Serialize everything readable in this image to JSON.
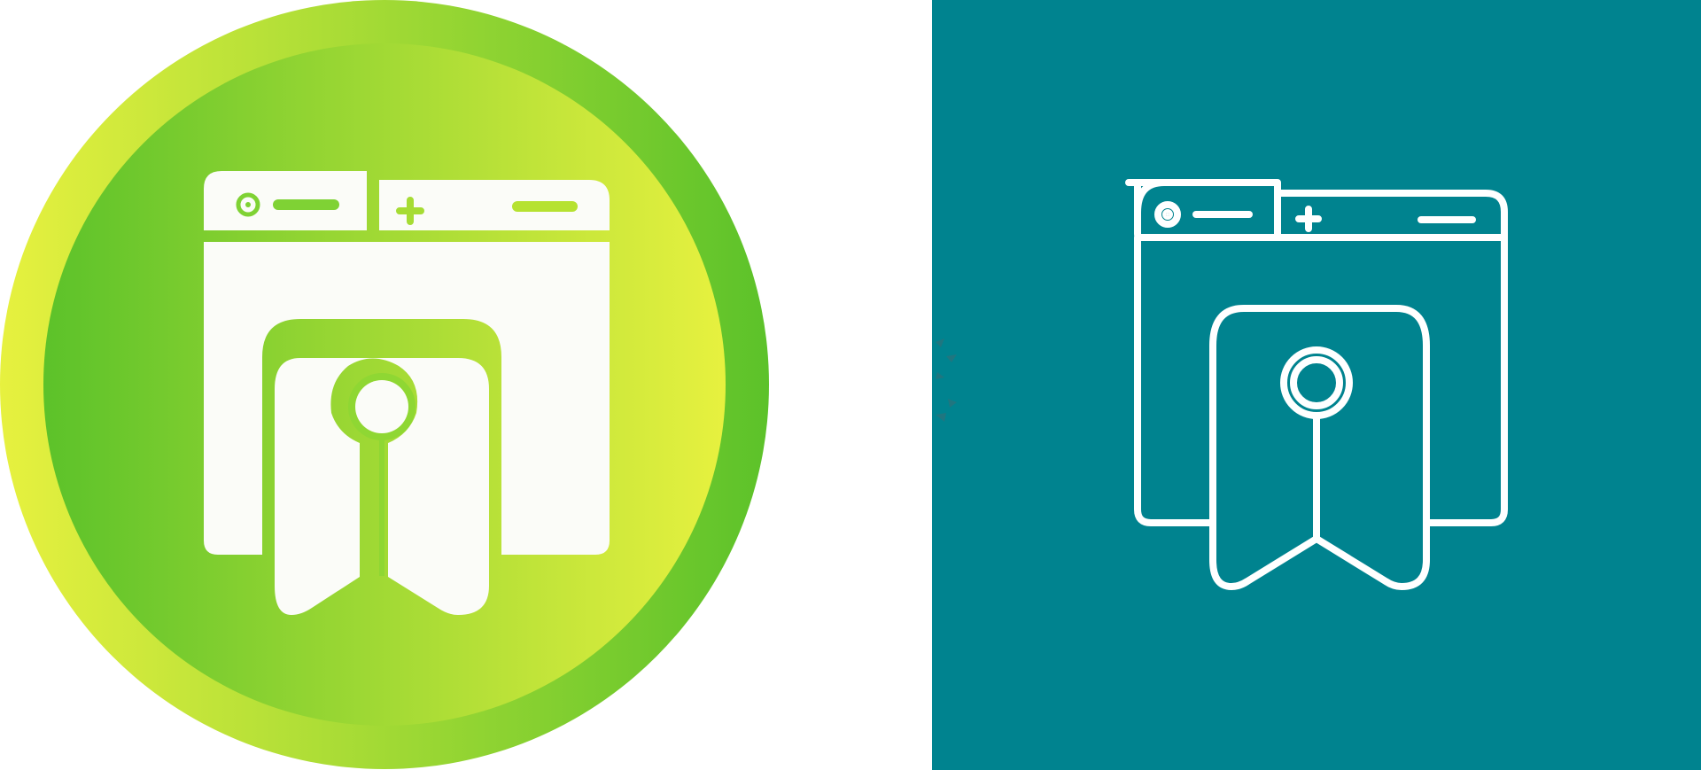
{
  "left_icon": {
    "variant": "gradient-glyph",
    "icon_name": "browser-bookmark-icon",
    "colors": {
      "outer_gradient_start": "#e7f13f",
      "outer_gradient_end": "#5cc22a",
      "inner_gradient_start": "#5cc22a",
      "inner_gradient_end": "#e7f13f",
      "glyph_fill": "#fbfcf8"
    }
  },
  "right_icon": {
    "variant": "line",
    "icon_name": "browser-bookmark-icon",
    "colors": {
      "background": "#00838f",
      "stroke": "#ffffff"
    }
  }
}
